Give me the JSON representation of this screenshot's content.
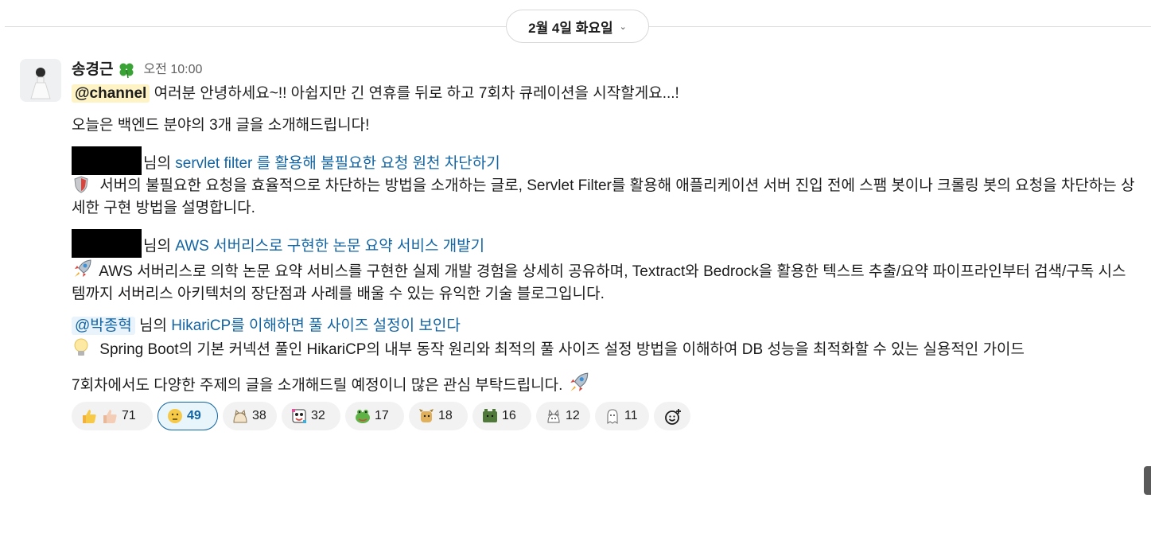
{
  "date_divider": {
    "label": "2월 4일 화요일",
    "chevron": "chevron-down-icon"
  },
  "message": {
    "sender": "송경근",
    "status_emoji": "clover-icon",
    "time": "오전 10:00",
    "intro_mention": "@channel",
    "intro_text": " 여러분 안녕하세요~!! 아쉽지만 긴 연휴를 뒤로 하고 7회차 큐레이션을 시작할게요...!",
    "line2": "오늘은 백엔드 분야의 3개 글을 소개해드립니다!",
    "posts": [
      {
        "author_suffix": "님의 ",
        "title": "servlet filter 를 활용해 불필요한 요청 원천 차단하기",
        "icon": "shield-icon",
        "description": " 서버의 불필요한 요청을 효율적으로 차단하는 방법을 소개하는 글로, Servlet Filter를 활용해 애플리케이션 서버 진입 전에 스팸 봇이나 크롤링 봇의 요청을 차단하는 상세한 구현 방법을 설명합니다."
      },
      {
        "author_suffix": "님의 ",
        "title": "AWS 서버리스로 구현한 논문 요약 서비스 개발기",
        "icon": "rocket-icon",
        "description": " AWS 서버리스로 의학 논문 요약 서비스를 구현한 실제 개발 경험을 상세히 공유하며, Textract와 Bedrock을 활용한 텍스트 추출/요약 파이프라인부터 검색/구독 시스템까지 서버리스 아키텍처의 장단점과 사례를 배울 수 있는 유익한 기술 블로그입니다."
      },
      {
        "author_mention": "@박종혁",
        "author_suffix": " 님의 ",
        "title": "HikariCP를 이해하면 풀 사이즈 설정이 보인다",
        "icon": "lightbulb-icon",
        "description": " Spring Boot의 기본 커넥션 풀인 HikariCP의 내부 동작 원리와 최적의 풀 사이즈 설정 방법을 이해하여 DB 성능을 최적화할 수 있는 실용적인 가이드"
      }
    ],
    "closing": "7회차에서도 다양한 주제의 글을 소개해드릴 예정이니 많은 관심 부탁드립니다. ",
    "closing_icon": "rocket-icon"
  },
  "reactions": [
    {
      "icon": "thumbs-up-icon",
      "count": "71",
      "active": false
    },
    {
      "icon": "thinking-face-icon",
      "count": "49",
      "active": true
    },
    {
      "icon": "cat-icon",
      "count": "38",
      "active": false
    },
    {
      "icon": "party-face-icon",
      "count": "32",
      "active": false
    },
    {
      "icon": "frog-icon",
      "count": "17",
      "active": false
    },
    {
      "icon": "dog-icon",
      "count": "18",
      "active": false
    },
    {
      "icon": "bear-icon",
      "count": "16",
      "active": false
    },
    {
      "icon": "cat-outline-icon",
      "count": "12",
      "active": false
    },
    {
      "icon": "ghost-icon",
      "count": "11",
      "active": false
    }
  ],
  "add_reaction": {
    "icon": "add-reaction-icon"
  },
  "colors": {
    "link": "#1264a3",
    "mention_bg": "#fdf3c5",
    "active_reaction_border": "#1264a3"
  }
}
